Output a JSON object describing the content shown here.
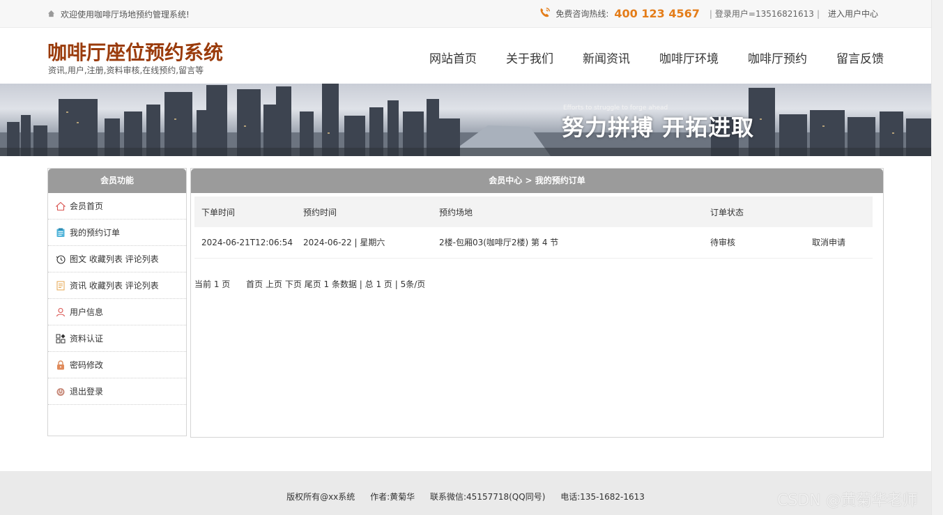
{
  "topbar": {
    "welcome": "欢迎使用咖啡厅场地预约管理系统!",
    "hotline_label": "免费咨询热线:",
    "hotline_number": "400 123 4567",
    "login_user": "登录用户=13516821613",
    "user_center": "进入用户中心"
  },
  "header": {
    "title": "咖啡厅座位预约系统",
    "subtitle": "资讯,用户,注册,资料审核,在线预约,留言等"
  },
  "nav": [
    "网站首页",
    "关于我们",
    "新闻资讯",
    "咖啡厅环境",
    "咖啡厅预约",
    "留言反馈"
  ],
  "banner": {
    "slogan_en": "Efforts to struggle to forge ahead",
    "slogan": "努力拼搏 开拓进取"
  },
  "sidebar": {
    "title": "会员功能",
    "items": [
      {
        "label": "会员首页",
        "icon": "home-icon"
      },
      {
        "label": "我的预约订单",
        "icon": "clipboard-icon"
      },
      {
        "label": "图文 收藏列表 评论列表",
        "icon": "history-icon"
      },
      {
        "label": "资讯 收藏列表 评论列表",
        "icon": "document-icon"
      },
      {
        "label": "用户信息",
        "icon": "user-icon"
      },
      {
        "label": "资料认证",
        "icon": "grid-icon"
      },
      {
        "label": "密码修改",
        "icon": "lock-icon"
      },
      {
        "label": "退出登录",
        "icon": "power-icon"
      }
    ]
  },
  "main": {
    "breadcrumb": "会员中心 > 我的预约订单",
    "columns": [
      "下单时间",
      "预约时间",
      "预约场地",
      "订单状态",
      ""
    ],
    "rows": [
      {
        "order_time": "2024-06-21T12:06:54",
        "book_time": "2024-06-22 | 星期六",
        "venue": "2楼-包厢03(咖啡厅2楼) 第 4 节",
        "status": "待审核",
        "action": "取消申请"
      }
    ],
    "pager": {
      "current": "当前 1 页",
      "first": "首页",
      "prev": "上页",
      "next": "下页",
      "last": "尾页",
      "summary": "1 条数据 | 总 1 页 | 5条/页"
    }
  },
  "footer": {
    "copyright": "版权所有@xx系统",
    "author": "作者:黄菊华",
    "wechat": "联系微信:45157718(QQ同号)",
    "phone": "电话:135-1682-1613"
  },
  "watermark": "CSDN @黄菊华老师",
  "colors": {
    "brand_title": "#9a3b0b",
    "hotline": "#e47d19",
    "panel_header": "#9b9b9b",
    "status_pending": "#cc1111"
  }
}
